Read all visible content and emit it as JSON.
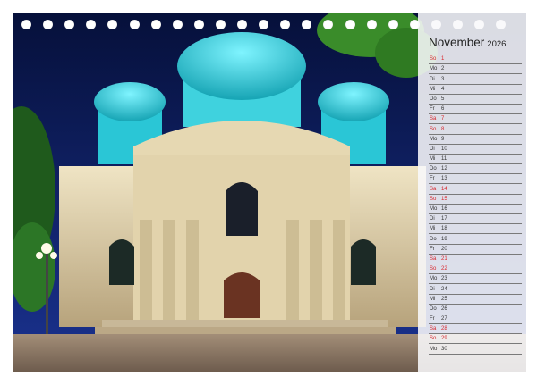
{
  "calendar": {
    "month": "November",
    "year": "2026",
    "weekend_color": "#d9262c",
    "days": [
      {
        "wd": "So",
        "d": "1",
        "we": true
      },
      {
        "wd": "Mo",
        "d": "2",
        "we": false
      },
      {
        "wd": "Di",
        "d": "3",
        "we": false
      },
      {
        "wd": "Mi",
        "d": "4",
        "we": false
      },
      {
        "wd": "Do",
        "d": "5",
        "we": false
      },
      {
        "wd": "Fr",
        "d": "6",
        "we": false
      },
      {
        "wd": "Sa",
        "d": "7",
        "we": true
      },
      {
        "wd": "So",
        "d": "8",
        "we": true
      },
      {
        "wd": "Mo",
        "d": "9",
        "we": false
      },
      {
        "wd": "Di",
        "d": "10",
        "we": false
      },
      {
        "wd": "Mi",
        "d": "11",
        "we": false
      },
      {
        "wd": "Do",
        "d": "12",
        "we": false
      },
      {
        "wd": "Fr",
        "d": "13",
        "we": false
      },
      {
        "wd": "Sa",
        "d": "14",
        "we": true
      },
      {
        "wd": "So",
        "d": "15",
        "we": true
      },
      {
        "wd": "Mo",
        "d": "16",
        "we": false
      },
      {
        "wd": "Di",
        "d": "17",
        "we": false
      },
      {
        "wd": "Mi",
        "d": "18",
        "we": false
      },
      {
        "wd": "Do",
        "d": "19",
        "we": false
      },
      {
        "wd": "Fr",
        "d": "20",
        "we": false
      },
      {
        "wd": "Sa",
        "d": "21",
        "we": true
      },
      {
        "wd": "So",
        "d": "22",
        "we": true
      },
      {
        "wd": "Mo",
        "d": "23",
        "we": false
      },
      {
        "wd": "Di",
        "d": "24",
        "we": false
      },
      {
        "wd": "Mi",
        "d": "25",
        "we": false
      },
      {
        "wd": "Do",
        "d": "26",
        "we": false
      },
      {
        "wd": "Fr",
        "d": "27",
        "we": false
      },
      {
        "wd": "Sa",
        "d": "28",
        "we": true
      },
      {
        "wd": "So",
        "d": "29",
        "we": true
      },
      {
        "wd": "Mo",
        "d": "30",
        "we": false
      }
    ]
  },
  "photo": {
    "subject": "church-photo",
    "sky_color": "#0b1c55",
    "dome_color": "#3fd6e0",
    "facade_color": "#d9c9a4"
  },
  "binding_holes": 23
}
